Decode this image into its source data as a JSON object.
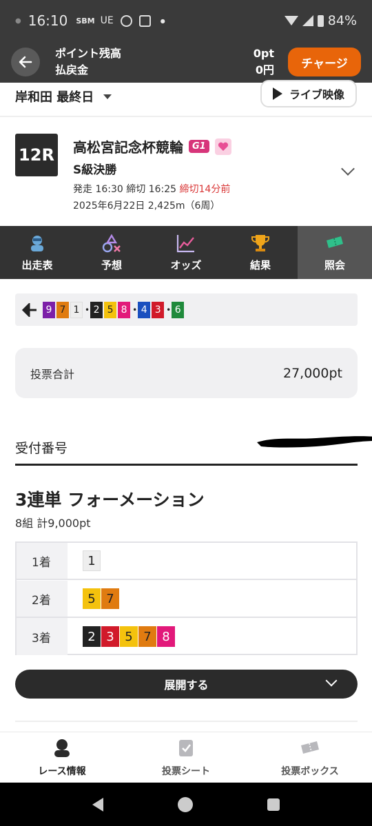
{
  "status_bar": {
    "time": "16:10",
    "indicators": [
      "SBM",
      "UE"
    ],
    "battery": "84%"
  },
  "header": {
    "point_label": "ポイント残高",
    "refund_label": "払戻金",
    "point_value": "0pt",
    "refund_value": "0円",
    "charge_label": "チャージ"
  },
  "venue": {
    "name": "岸和田 最終日",
    "live_label": "ライブ映像"
  },
  "race": {
    "number": "12R",
    "title": "高松宮記念杯競輪",
    "grade": "G1",
    "class": "S級決勝",
    "start": "発走 16:30 締切 16:25",
    "deadline": "締切14分前",
    "date_info": "2025年6月22日 2,425m（6周）"
  },
  "tabs": [
    {
      "label": "出走表",
      "icon": "racer-icon"
    },
    {
      "label": "予想",
      "icon": "prediction-icon"
    },
    {
      "label": "オッズ",
      "icon": "odds-chart-icon"
    },
    {
      "label": "結果",
      "icon": "trophy-icon"
    },
    {
      "label": "照会",
      "icon": "ticket-icon"
    }
  ],
  "line_formation": [
    {
      "n": "9",
      "c": "c9"
    },
    {
      "n": "7",
      "c": "c7"
    },
    {
      "n": "1",
      "c": "c1"
    },
    {
      "sep": "•"
    },
    {
      "n": "2",
      "c": "c2"
    },
    {
      "n": "5",
      "c": "c5"
    },
    {
      "n": "8",
      "c": "c8"
    },
    {
      "sep": "•"
    },
    {
      "n": "4",
      "c": "c4"
    },
    {
      "n": "3",
      "c": "c3"
    },
    {
      "sep": "•"
    },
    {
      "n": "6",
      "c": "c6"
    }
  ],
  "total": {
    "label": "投票合計",
    "value": "27,000pt"
  },
  "receipt": {
    "label": "受付番号"
  },
  "bet": {
    "title": "3連単 フォーメーション",
    "summary": "8組 計9,000pt",
    "rows": [
      {
        "place": "1着",
        "numbers": [
          "1"
        ]
      },
      {
        "place": "2着",
        "numbers": [
          "5",
          "7"
        ]
      },
      {
        "place": "3着",
        "numbers": [
          "2",
          "3",
          "5",
          "7",
          "8"
        ]
      }
    ]
  },
  "expand_label": "展開する",
  "bottom_nav": [
    {
      "label": "レース情報",
      "icon": "racer-icon"
    },
    {
      "label": "投票シート",
      "icon": "sheet-icon"
    },
    {
      "label": "投票ボックス",
      "icon": "ticket-icon"
    }
  ],
  "colors": {
    "accent": "#e8650a",
    "header_bg": "#3a3a3a",
    "deadline_red": "#d93636",
    "g1_pink": "#d7357a"
  }
}
